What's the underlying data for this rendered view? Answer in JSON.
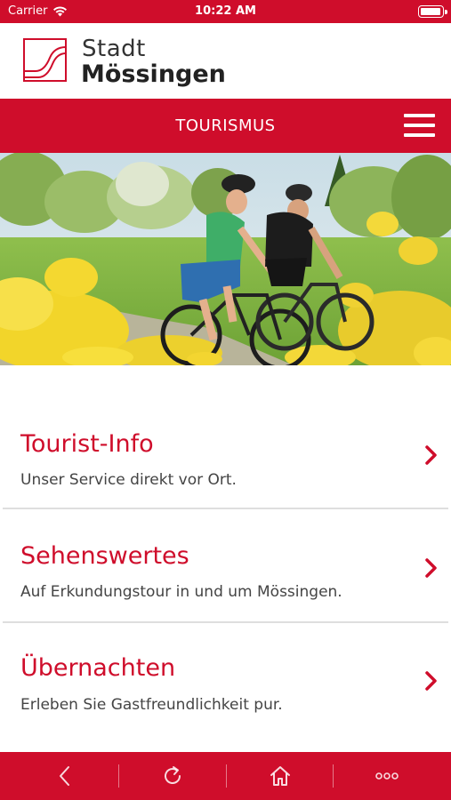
{
  "status_bar": {
    "carrier": "Carrier",
    "time": "10:22 AM",
    "battery_level": 1.0
  },
  "header": {
    "logo_line1": "Stadt",
    "logo_line2": "Mössingen"
  },
  "nav": {
    "title": "TOURISMUS",
    "menu_icon": "hamburger-icon"
  },
  "hero": {
    "image": "two cyclists riding mountain bikes past yellow rapeseed flowers"
  },
  "list": {
    "items": [
      {
        "title": "Tourist-Info",
        "subtitle": "Unser Service direkt vor Ort."
      },
      {
        "title": "Sehenswertes",
        "subtitle": "Auf Erkundungstour in und um Mössingen."
      },
      {
        "title": "Übernachten",
        "subtitle": "Erleben Sie Gastfreundlichkeit pur."
      }
    ]
  },
  "toolbar": {
    "buttons": [
      "back-icon",
      "reload-icon",
      "home-icon",
      "more-icon"
    ]
  },
  "colors": {
    "brand": "#cf0d2b",
    "text": "#444444",
    "divider": "#dedede"
  }
}
